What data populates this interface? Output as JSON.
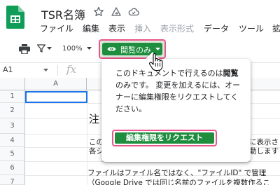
{
  "app": {
    "document_title": "TSR名簿",
    "icons": [
      "sheets-logo-icon",
      "star-icon",
      "move-to-folder-icon",
      "cloud-status-icon"
    ]
  },
  "menu": {
    "items": [
      {
        "label": "ファイル",
        "enabled": true
      },
      {
        "label": "編集",
        "enabled": true
      },
      {
        "label": "表示",
        "enabled": true
      },
      {
        "label": "挿入",
        "enabled": false
      },
      {
        "label": "表示形式",
        "enabled": false
      },
      {
        "label": "データ",
        "enabled": true
      },
      {
        "label": "ツール",
        "enabled": true
      },
      {
        "label": "拡",
        "enabled": true
      }
    ]
  },
  "toolbar": {
    "zoom": "100%",
    "view_only_label": "閲覧のみ",
    "icons": [
      "print-icon",
      "filter-icon",
      "zoom-dropdown-icon",
      "eye-icon",
      "dropdown-caret-icon"
    ]
  },
  "formula_bar": {
    "name_box": "A1",
    "fx": "fx"
  },
  "grid": {
    "column_a": "A",
    "rows": [
      "1",
      "2",
      "3",
      "4",
      "5",
      "6",
      "7"
    ],
    "heading": "注",
    "cells": [
      "この",
      "各シ",
      "に表示さ",
      "動します",
      "ファイルはファイル名ではなく、\"ファイルID\" で管理",
      "（Google Drive では同じ名前のファイルを複数作るこ"
    ]
  },
  "popup": {
    "text_before": "このドキュメントで行えるのは",
    "text_bold": "閲覧",
    "text_after": "のみです。 変更を加えるには、オーナーに編集権限をリクエストしてください。",
    "request_button": "編集権限をリクエスト"
  },
  "colors": {
    "accent_green": "#1e8e3e",
    "highlight_pink": "#e8578c",
    "selection_blue": "#1a73e8"
  }
}
